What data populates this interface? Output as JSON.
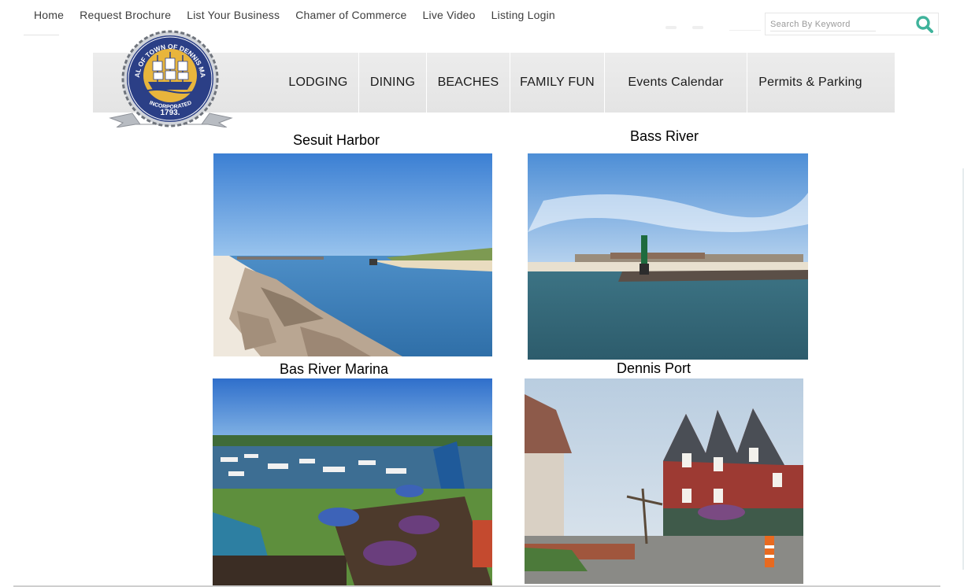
{
  "top_nav": {
    "items": [
      {
        "id": "home",
        "label": "Home"
      },
      {
        "id": "request-brochure",
        "label": "Request Brochure"
      },
      {
        "id": "list-your-business",
        "label": "List Your Business"
      },
      {
        "id": "chamber-of-commerce",
        "label": "Chamer of Commerce"
      },
      {
        "id": "live-video",
        "label": "Live Video"
      },
      {
        "id": "listing-login",
        "label": "Listing Login"
      }
    ]
  },
  "search": {
    "placeholder": "Search By Keyword",
    "icon": "search-icon",
    "icon_color": "#3fb39b"
  },
  "seal": {
    "ring_text_top": "SEAL OF TOWN OF DENNIS MASS",
    "incorporated": "INCORPORATED",
    "year": "1793.",
    "colors": {
      "navy": "#2b3f86",
      "gold": "#e8b53c",
      "silver": "#9da3ab"
    }
  },
  "main_nav": {
    "items": [
      {
        "id": "lodging",
        "label": "LODGING"
      },
      {
        "id": "dining",
        "label": "DINING"
      },
      {
        "id": "beaches",
        "label": "BEACHES"
      },
      {
        "id": "family-fun",
        "label": "FAMILY FUN"
      },
      {
        "id": "events-calendar",
        "label": "Events Calendar"
      },
      {
        "id": "permits-parking",
        "label": "Permits & Parking"
      }
    ]
  },
  "gallery": {
    "items": [
      {
        "id": "sesuit-harbor",
        "caption": "Sesuit Harbor"
      },
      {
        "id": "bass-river",
        "caption": "Bass River"
      },
      {
        "id": "bas-river-marina",
        "caption": "Bas River Marina"
      },
      {
        "id": "dennis-port",
        "caption": "Dennis Port"
      }
    ]
  }
}
